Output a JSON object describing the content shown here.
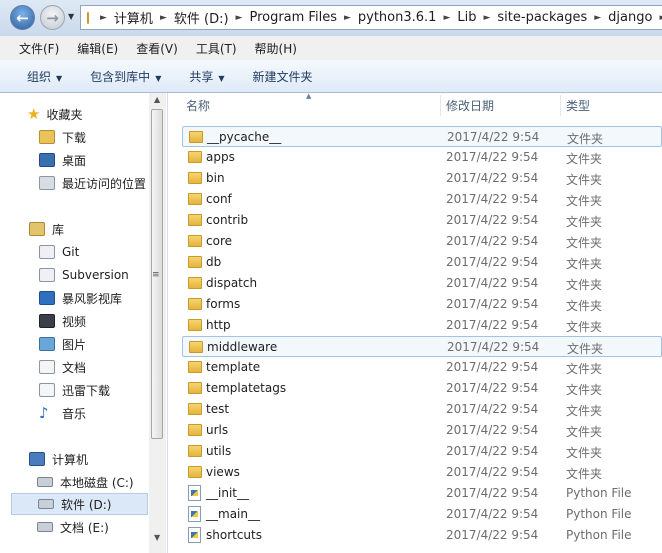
{
  "address": {
    "crumbs": [
      "计算机",
      "软件 (D:)",
      "Program Files",
      "python3.6.1",
      "Lib",
      "site-packages",
      "django"
    ]
  },
  "menu": [
    "文件(F)",
    "编辑(E)",
    "查看(V)",
    "工具(T)",
    "帮助(H)"
  ],
  "toolbar": {
    "organize": "组织",
    "include_library": "包含到库中",
    "share": "共享",
    "new_folder": "新建文件夹"
  },
  "nav": {
    "favorites": "收藏夹",
    "downloads": "下载",
    "desktop": "桌面",
    "recent": "最近访问的位置",
    "libraries": "库",
    "git": "Git",
    "subversion": "Subversion",
    "storm": "暴风影视库",
    "videos": "视频",
    "pictures": "图片",
    "documents": "文档",
    "thunder": "迅雷下载",
    "music": "音乐",
    "computer": "计算机",
    "drive_c": "本地磁盘 (C:)",
    "drive_d": "软件 (D:)",
    "drive_e": "文档 (E:)"
  },
  "columns": {
    "name": "名称",
    "date": "修改日期",
    "type": "类型"
  },
  "files": [
    {
      "name": "__pycache__",
      "date": "2017/4/22 9:54",
      "type": "文件夹",
      "kind": "folder"
    },
    {
      "name": "apps",
      "date": "2017/4/22 9:54",
      "type": "文件夹",
      "kind": "folder"
    },
    {
      "name": "bin",
      "date": "2017/4/22 9:54",
      "type": "文件夹",
      "kind": "folder"
    },
    {
      "name": "conf",
      "date": "2017/4/22 9:54",
      "type": "文件夹",
      "kind": "folder"
    },
    {
      "name": "contrib",
      "date": "2017/4/22 9:54",
      "type": "文件夹",
      "kind": "folder"
    },
    {
      "name": "core",
      "date": "2017/4/22 9:54",
      "type": "文件夹",
      "kind": "folder"
    },
    {
      "name": "db",
      "date": "2017/4/22 9:54",
      "type": "文件夹",
      "kind": "folder"
    },
    {
      "name": "dispatch",
      "date": "2017/4/22 9:54",
      "type": "文件夹",
      "kind": "folder"
    },
    {
      "name": "forms",
      "date": "2017/4/22 9:54",
      "type": "文件夹",
      "kind": "folder"
    },
    {
      "name": "http",
      "date": "2017/4/22 9:54",
      "type": "文件夹",
      "kind": "folder"
    },
    {
      "name": "middleware",
      "date": "2017/4/22 9:54",
      "type": "文件夹",
      "kind": "folder"
    },
    {
      "name": "template",
      "date": "2017/4/22 9:54",
      "type": "文件夹",
      "kind": "folder"
    },
    {
      "name": "templatetags",
      "date": "2017/4/22 9:54",
      "type": "文件夹",
      "kind": "folder"
    },
    {
      "name": "test",
      "date": "2017/4/22 9:54",
      "type": "文件夹",
      "kind": "folder"
    },
    {
      "name": "urls",
      "date": "2017/4/22 9:54",
      "type": "文件夹",
      "kind": "folder"
    },
    {
      "name": "utils",
      "date": "2017/4/22 9:54",
      "type": "文件夹",
      "kind": "folder"
    },
    {
      "name": "views",
      "date": "2017/4/22 9:54",
      "type": "文件夹",
      "kind": "folder"
    },
    {
      "name": "__init__",
      "date": "2017/4/22 9:54",
      "type": "Python File",
      "kind": "python-file"
    },
    {
      "name": "__main__",
      "date": "2017/4/22 9:54",
      "type": "Python File",
      "kind": "python-file"
    },
    {
      "name": "shortcuts",
      "date": "2017/4/22 9:54",
      "type": "Python File",
      "kind": "python-file"
    }
  ]
}
